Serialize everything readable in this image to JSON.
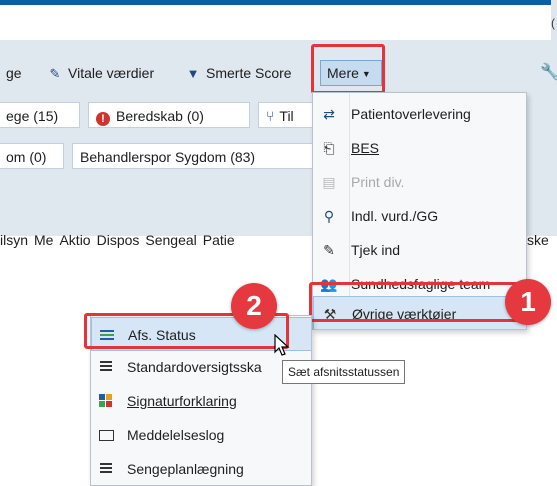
{
  "toolbar": {
    "item_partial": "ge",
    "vitale": "Vitale værdier",
    "smerte": "Smerte Score",
    "mere": "Mere",
    "corner_mark": "("
  },
  "filters": {
    "row1": [
      "ege (15)",
      "Beredskab (0)",
      "Til"
    ],
    "row2": [
      "om (0)",
      "Behandlerspor Sygdom (83)"
    ]
  },
  "columns": [
    "ilsyn",
    "Me",
    "Aktio",
    "Dispos",
    "Sengeal",
    "Patie"
  ],
  "columns_last": "ske",
  "menu": {
    "items": [
      {
        "label": "Patientoverlevering",
        "icon": "patient-transfer-icon",
        "disabled": false
      },
      {
        "label": "BES",
        "icon": "bes-icon",
        "disabled": false
      },
      {
        "label": "Print div.",
        "icon": "print-icon",
        "disabled": true
      },
      {
        "label": "Indl. vurd./GG",
        "icon": "assessment-icon",
        "disabled": false
      },
      {
        "label": "Tjek ind",
        "icon": "pen-icon",
        "disabled": false
      },
      {
        "label": "Sundhedsfaglige team",
        "icon": "team-icon",
        "disabled": false
      },
      {
        "label": "Øvrige værktøjer",
        "icon": "hammer-icon",
        "disabled": false
      }
    ]
  },
  "submenu": {
    "items": [
      {
        "label": "Afs. Status",
        "icon": "status-icon"
      },
      {
        "label": "Standardoversigtsska",
        "icon": "list-icon"
      },
      {
        "label": "Signaturforklaring",
        "icon": "signature-icon"
      },
      {
        "label": "Meddelelseslog",
        "icon": "message-icon"
      },
      {
        "label": "Sengeplanlægning",
        "icon": "list-icon"
      }
    ]
  },
  "tooltip": "Sæt afsnitsstatussen",
  "badges": [
    "1",
    "2"
  ],
  "colors": {
    "accent": "#0b5fa8",
    "highlight": "#e5333a",
    "badge": "#e5383f"
  }
}
